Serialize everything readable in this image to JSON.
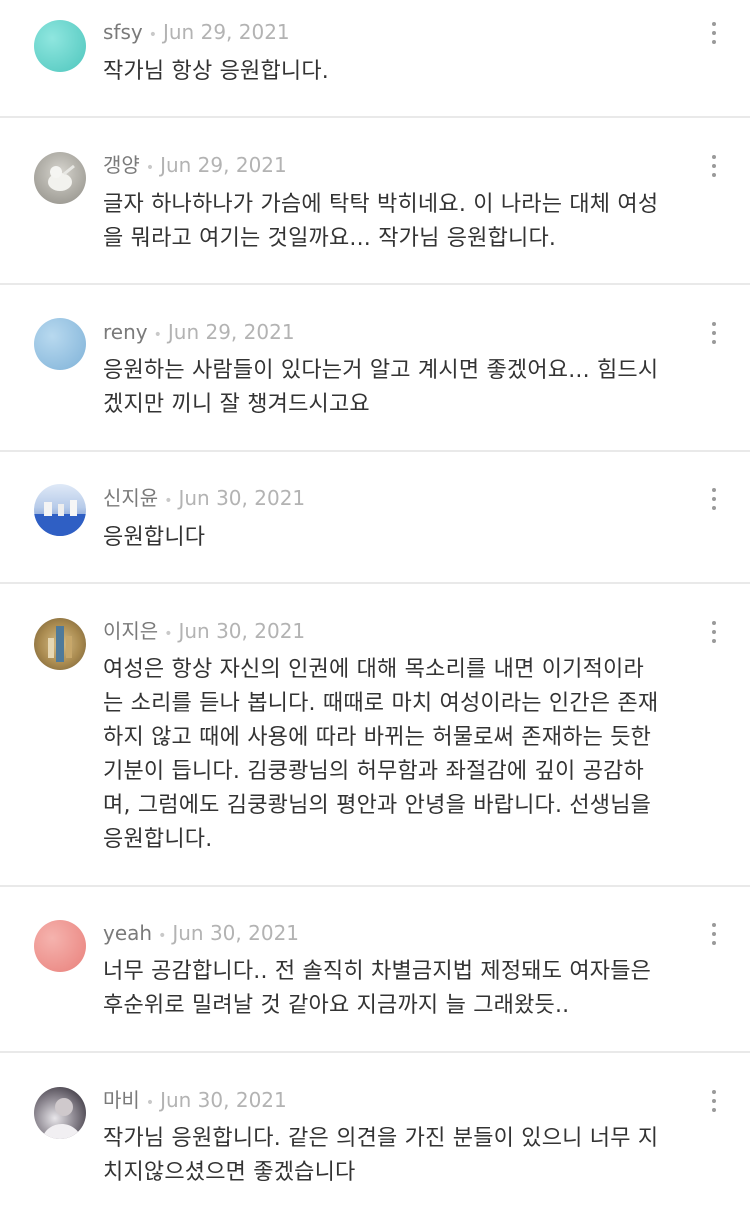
{
  "comments": [
    {
      "author": "sfsy",
      "date": "Jun 29, 2021",
      "lines": [
        "작가님 항상 응원합니다."
      ],
      "avatar_color": "#5ed0c8"
    },
    {
      "author": "갱양",
      "date": "Jun 29, 2021",
      "lines": [
        "글자 하나하나가 가슴에 탁탁 박히네요. 이 나라는 대체 여성",
        "을 뭐라고 여기는 것일까요... 작가님 응원합니다."
      ],
      "avatar_color": "#a5a39c"
    },
    {
      "author": "reny",
      "date": "Jun 29, 2021",
      "lines": [
        "응원하는 사람들이 있다는거 알고 계시면 좋겠어요... 힘드시",
        "겠지만 끼니 잘 챙겨드시고요"
      ],
      "avatar_color": "#8fbfe0"
    },
    {
      "author": "신지윤",
      "date": "Jun 30, 2021",
      "lines": [
        "응원합니다"
      ],
      "avatar_color": "#4a78c8"
    },
    {
      "author": "이지은",
      "date": "Jun 30, 2021",
      "lines": [
        "여성은 항상 자신의 인권에 대해 목소리를 내면 이기적이라",
        "는 소리를 듣나 봅니다. 때때로 마치 여성이라는 인간은 존재",
        "하지 않고 때에 사용에 따라 바뀌는 허물로써 존재하는 듯한",
        "기분이 듭니다. 김쿵쾅님의 허무함과 좌절감에 깊이 공감하",
        "며, 그럼에도 김쿵쾅님의 평안과 안녕을 바랍니다. 선생님을",
        "응원합니다."
      ],
      "avatar_color": "#b08a4a"
    },
    {
      "author": "yeah",
      "date": "Jun 30, 2021",
      "lines": [
        "너무 공감합니다.. 전 솔직히 차별금지법 제정돼도 여자들은",
        "후순위로 밀려날 것 같아요 지금까지 늘 그래왔듯.."
      ],
      "avatar_color": "#ee8f8b"
    },
    {
      "author": "마비",
      "date": "Jun 30, 2021",
      "lines": [
        "작가님 응원합니다. 같은 의견을 가진 분들이 있으니 너무 지",
        "치지않으셨으면 좋겠습니다"
      ],
      "avatar_color": "#2a2430"
    }
  ],
  "separator": "•"
}
